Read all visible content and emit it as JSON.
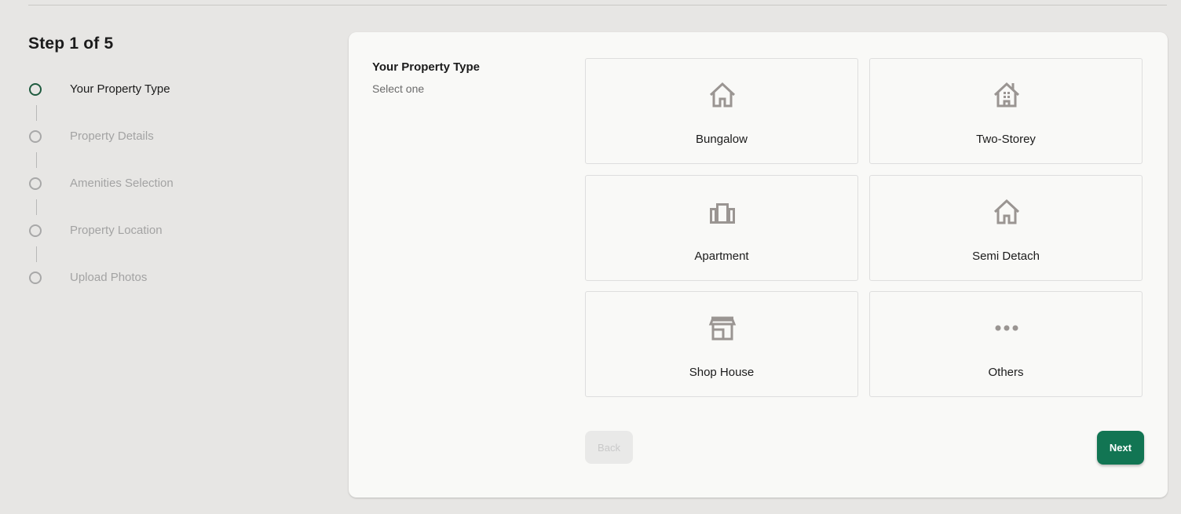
{
  "wizard": {
    "step_indicator": "Step 1 of 5",
    "steps": [
      {
        "label": "Your Property Type",
        "active": true
      },
      {
        "label": "Property Details",
        "active": false
      },
      {
        "label": "Amenities Selection",
        "active": false
      },
      {
        "label": "Property Location",
        "active": false
      },
      {
        "label": "Upload Photos",
        "active": false
      }
    ]
  },
  "form": {
    "title": "Your Property Type",
    "subtitle": "Select one",
    "options": [
      {
        "label": "Bungalow",
        "icon": "house-icon"
      },
      {
        "label": "Two-Storey",
        "icon": "two-storey-house-icon"
      },
      {
        "label": "Apartment",
        "icon": "apartment-building-icon"
      },
      {
        "label": "Semi Detach",
        "icon": "semi-detached-house-icon"
      },
      {
        "label": "Shop House",
        "icon": "storefront-icon"
      },
      {
        "label": "Others",
        "icon": "more-dots-icon"
      }
    ],
    "back_label": "Back",
    "next_label": "Next"
  },
  "colors": {
    "page_background": "#e7e6e4",
    "card_background": "#f9f9f7",
    "accent_green": "#127553",
    "active_step_ring": "#1f5b3f",
    "icon_gray": "#9a9592"
  }
}
